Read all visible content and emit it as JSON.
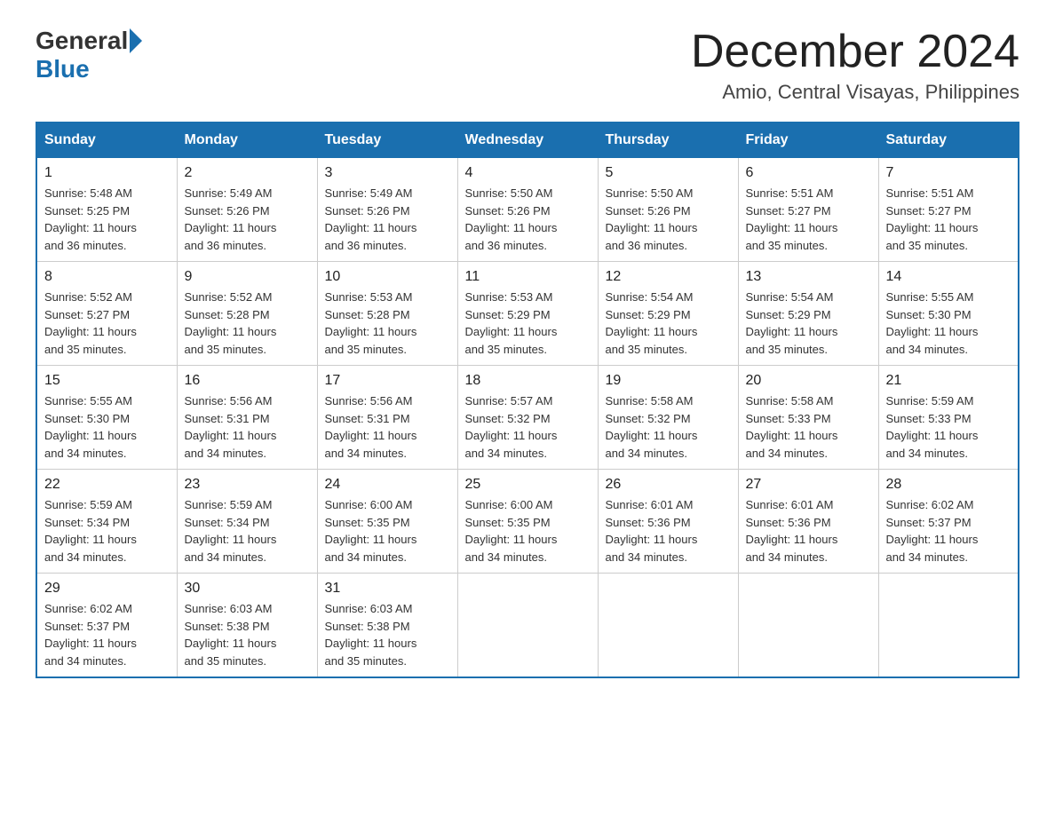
{
  "logo": {
    "text_general": "General",
    "text_blue": "Blue"
  },
  "title": {
    "month_year": "December 2024",
    "location": "Amio, Central Visayas, Philippines"
  },
  "days_of_week": [
    "Sunday",
    "Monday",
    "Tuesday",
    "Wednesday",
    "Thursday",
    "Friday",
    "Saturday"
  ],
  "weeks": [
    [
      {
        "day": "1",
        "sunrise": "5:48 AM",
        "sunset": "5:25 PM",
        "daylight": "11 hours and 36 minutes."
      },
      {
        "day": "2",
        "sunrise": "5:49 AM",
        "sunset": "5:26 PM",
        "daylight": "11 hours and 36 minutes."
      },
      {
        "day": "3",
        "sunrise": "5:49 AM",
        "sunset": "5:26 PM",
        "daylight": "11 hours and 36 minutes."
      },
      {
        "day": "4",
        "sunrise": "5:50 AM",
        "sunset": "5:26 PM",
        "daylight": "11 hours and 36 minutes."
      },
      {
        "day": "5",
        "sunrise": "5:50 AM",
        "sunset": "5:26 PM",
        "daylight": "11 hours and 36 minutes."
      },
      {
        "day": "6",
        "sunrise": "5:51 AM",
        "sunset": "5:27 PM",
        "daylight": "11 hours and 35 minutes."
      },
      {
        "day": "7",
        "sunrise": "5:51 AM",
        "sunset": "5:27 PM",
        "daylight": "11 hours and 35 minutes."
      }
    ],
    [
      {
        "day": "8",
        "sunrise": "5:52 AM",
        "sunset": "5:27 PM",
        "daylight": "11 hours and 35 minutes."
      },
      {
        "day": "9",
        "sunrise": "5:52 AM",
        "sunset": "5:28 PM",
        "daylight": "11 hours and 35 minutes."
      },
      {
        "day": "10",
        "sunrise": "5:53 AM",
        "sunset": "5:28 PM",
        "daylight": "11 hours and 35 minutes."
      },
      {
        "day": "11",
        "sunrise": "5:53 AM",
        "sunset": "5:29 PM",
        "daylight": "11 hours and 35 minutes."
      },
      {
        "day": "12",
        "sunrise": "5:54 AM",
        "sunset": "5:29 PM",
        "daylight": "11 hours and 35 minutes."
      },
      {
        "day": "13",
        "sunrise": "5:54 AM",
        "sunset": "5:29 PM",
        "daylight": "11 hours and 35 minutes."
      },
      {
        "day": "14",
        "sunrise": "5:55 AM",
        "sunset": "5:30 PM",
        "daylight": "11 hours and 34 minutes."
      }
    ],
    [
      {
        "day": "15",
        "sunrise": "5:55 AM",
        "sunset": "5:30 PM",
        "daylight": "11 hours and 34 minutes."
      },
      {
        "day": "16",
        "sunrise": "5:56 AM",
        "sunset": "5:31 PM",
        "daylight": "11 hours and 34 minutes."
      },
      {
        "day": "17",
        "sunrise": "5:56 AM",
        "sunset": "5:31 PM",
        "daylight": "11 hours and 34 minutes."
      },
      {
        "day": "18",
        "sunrise": "5:57 AM",
        "sunset": "5:32 PM",
        "daylight": "11 hours and 34 minutes."
      },
      {
        "day": "19",
        "sunrise": "5:58 AM",
        "sunset": "5:32 PM",
        "daylight": "11 hours and 34 minutes."
      },
      {
        "day": "20",
        "sunrise": "5:58 AM",
        "sunset": "5:33 PM",
        "daylight": "11 hours and 34 minutes."
      },
      {
        "day": "21",
        "sunrise": "5:59 AM",
        "sunset": "5:33 PM",
        "daylight": "11 hours and 34 minutes."
      }
    ],
    [
      {
        "day": "22",
        "sunrise": "5:59 AM",
        "sunset": "5:34 PM",
        "daylight": "11 hours and 34 minutes."
      },
      {
        "day": "23",
        "sunrise": "5:59 AM",
        "sunset": "5:34 PM",
        "daylight": "11 hours and 34 minutes."
      },
      {
        "day": "24",
        "sunrise": "6:00 AM",
        "sunset": "5:35 PM",
        "daylight": "11 hours and 34 minutes."
      },
      {
        "day": "25",
        "sunrise": "6:00 AM",
        "sunset": "5:35 PM",
        "daylight": "11 hours and 34 minutes."
      },
      {
        "day": "26",
        "sunrise": "6:01 AM",
        "sunset": "5:36 PM",
        "daylight": "11 hours and 34 minutes."
      },
      {
        "day": "27",
        "sunrise": "6:01 AM",
        "sunset": "5:36 PM",
        "daylight": "11 hours and 34 minutes."
      },
      {
        "day": "28",
        "sunrise": "6:02 AM",
        "sunset": "5:37 PM",
        "daylight": "11 hours and 34 minutes."
      }
    ],
    [
      {
        "day": "29",
        "sunrise": "6:02 AM",
        "sunset": "5:37 PM",
        "daylight": "11 hours and 34 minutes."
      },
      {
        "day": "30",
        "sunrise": "6:03 AM",
        "sunset": "5:38 PM",
        "daylight": "11 hours and 35 minutes."
      },
      {
        "day": "31",
        "sunrise": "6:03 AM",
        "sunset": "5:38 PM",
        "daylight": "11 hours and 35 minutes."
      },
      null,
      null,
      null,
      null
    ]
  ],
  "labels": {
    "sunrise": "Sunrise:",
    "sunset": "Sunset:",
    "daylight": "Daylight:"
  }
}
